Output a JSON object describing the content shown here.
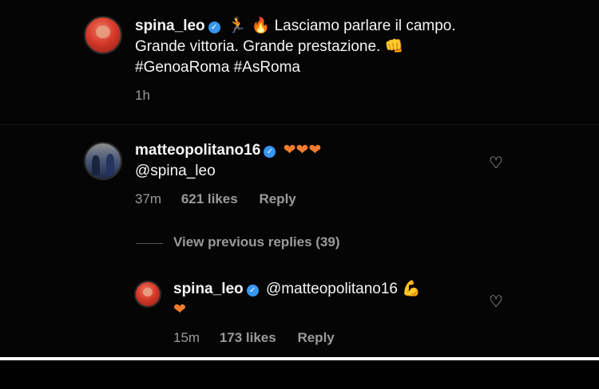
{
  "post": {
    "username": "spina_leo",
    "emojis": "🏃 🔥",
    "caption_line1": "Lasciamo parlare il campo.",
    "caption_line2": "Grande vittoria. Grande prestazione. 👊",
    "caption_line3": "#GenoaRoma #AsRoma",
    "time": "1h"
  },
  "comment": {
    "username": "matteopolitano16",
    "hearts": "❤❤❤",
    "text": "@spina_leo",
    "time": "37m",
    "likes": "621 likes",
    "reply_label": "Reply"
  },
  "view_replies": "View previous replies (39)",
  "reply": {
    "username": "spina_leo",
    "text": "@matteopolitano16 💪",
    "heart": "❤",
    "time": "15m",
    "likes": "173 likes",
    "reply_label": "Reply"
  },
  "colors": {
    "background": "#050505",
    "verified": "#3897f0",
    "heart": "#f27c2e",
    "muted_text": "#9a9a9a"
  },
  "icons": {
    "like": "heart-outline-icon",
    "verified": "verified-badge-icon"
  }
}
